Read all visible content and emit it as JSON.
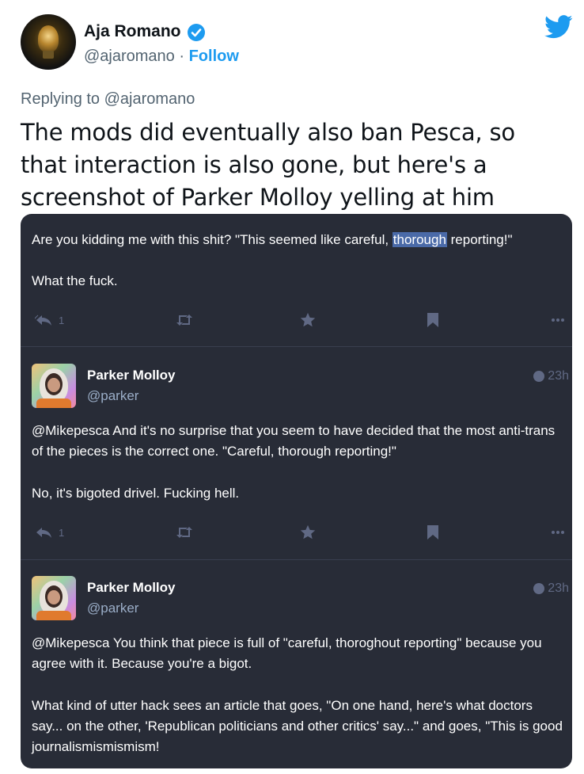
{
  "author": {
    "name": "Aja Romano",
    "handle": "@ajaromano",
    "separator": " · ",
    "follow_label": "Follow"
  },
  "replying_to": "Replying to @ajaromano",
  "tweet_text": "The mods did eventually also ban Pesca, so that interaction is also gone, but here's a screenshot of Parker Molloy yelling at him",
  "colors": {
    "twitter_blue": "#1d9bf0",
    "screenshot_bg": "#282c37",
    "muted_icon": "#606984"
  },
  "screenshot": {
    "post1": {
      "line1_before": "Are you kidding me with this shit? \"This seemed like careful, ",
      "line1_highlight": "thorough",
      "line1_after": " reporting!\"",
      "line2": "What the fuck.",
      "reply_count": "1"
    },
    "post2": {
      "name": "Parker Molloy",
      "handle": "@parker",
      "time": "23h",
      "para1": "@Mikepesca And it's no surprise that you seem to have decided that the most anti-trans of the pieces is the correct one. \"Careful, thorough reporting!\"",
      "para2": "No, it's bigoted drivel. Fucking hell.",
      "reply_count": "1"
    },
    "post3": {
      "name": "Parker Molloy",
      "handle": "@parker",
      "time": "23h",
      "para1": "@Mikepesca You think that piece is full of \"careful, thoroghout reporting\" because you agree with it. Because you're a bigot.",
      "para2": "What kind of utter hack sees an article that goes, \"On one hand, here's what doctors say... on the other, 'Republican politicians and other critics' say...\" and goes, \"This is good journalismismismism!"
    },
    "icons": [
      "reply-all-icon",
      "boost-icon",
      "star-icon",
      "bookmark-icon",
      "more-icon",
      "globe-icon"
    ]
  }
}
